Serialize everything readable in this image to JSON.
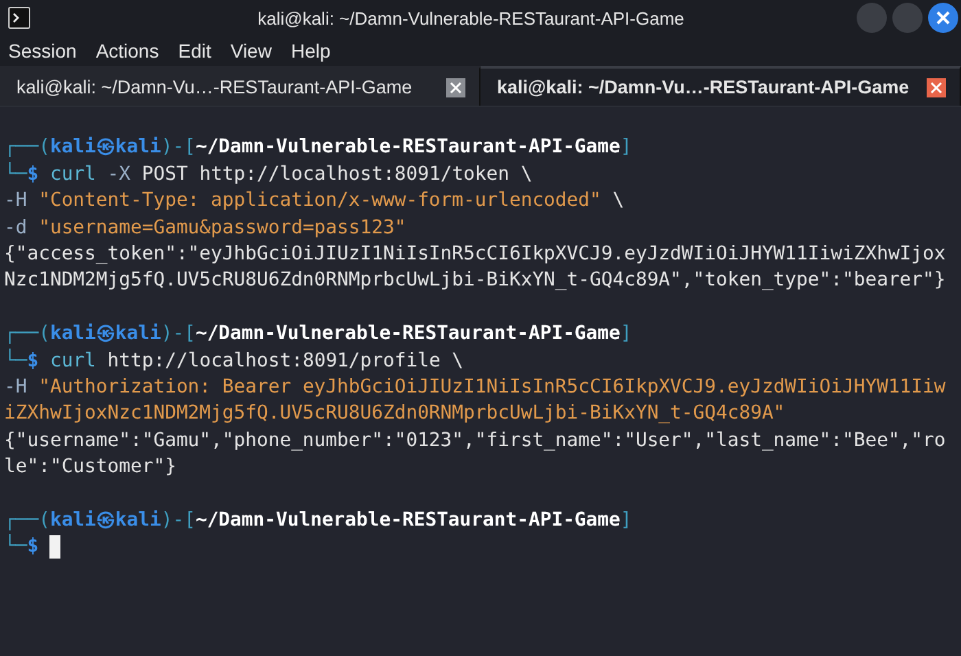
{
  "window": {
    "title": "kali@kali: ~/Damn-Vulnerable-RESTaurant-API-Game"
  },
  "menu": [
    "Session",
    "Actions",
    "Edit",
    "View",
    "Help"
  ],
  "tabs": [
    {
      "label": "kali@kali: ~/Damn-Vu…-RESTaurant-API-Game",
      "selected": false
    },
    {
      "label": "kali@kali: ~/Damn-Vu…-RESTaurant-API-Game",
      "selected": true
    }
  ],
  "terminal": {
    "lines": [
      {
        "kind": "blank"
      },
      {
        "kind": "prompt",
        "segments": [
          {
            "kind": "frame",
            "text": "┌──("
          },
          {
            "kind": "user",
            "text": "kali㉿kali"
          },
          {
            "kind": "frame",
            "text": ")-["
          },
          {
            "kind": "path",
            "text": "~/Damn-Vulnerable-RESTaurant-API-Game"
          },
          {
            "kind": "frame",
            "text": "]"
          }
        ]
      },
      {
        "kind": "command",
        "segments": [
          {
            "kind": "frame",
            "text": "└─"
          },
          {
            "kind": "dollar",
            "text": "$ "
          },
          {
            "kind": "cmd",
            "text": "curl "
          },
          {
            "kind": "option",
            "text": "-X "
          },
          {
            "kind": "plain",
            "text": "POST http://localhost:8091/token \\"
          }
        ]
      },
      {
        "kind": "command",
        "segments": [
          {
            "kind": "option",
            "text": "-H "
          },
          {
            "kind": "string",
            "text": "\"Content-Type: application/x-www-form-urlencoded\""
          },
          {
            "kind": "plain",
            "text": " \\"
          }
        ]
      },
      {
        "kind": "command",
        "segments": [
          {
            "kind": "option",
            "text": "-d "
          },
          {
            "kind": "string",
            "text": "\"username=Gamu&password=pass123\""
          }
        ]
      },
      {
        "kind": "output",
        "segments": [
          {
            "kind": "plain",
            "text": "{\"access_token\":\"eyJhbGciOiJIUzI1NiIsInR5cCI6IkpXVCJ9.eyJzdWIiOiJHYW11IiwiZXhwIjox"
          }
        ]
      },
      {
        "kind": "output",
        "segments": [
          {
            "kind": "plain",
            "text": "Nzc1NDM2Mjg5fQ.UV5cRU8U6Zdn0RNMprbcUwLjbi-BiKxYN_t-GQ4c89A\",\"token_type\":\"bearer\"}"
          }
        ]
      },
      {
        "kind": "blank"
      },
      {
        "kind": "prompt",
        "segments": [
          {
            "kind": "frame",
            "text": "┌──("
          },
          {
            "kind": "user",
            "text": "kali㉿kali"
          },
          {
            "kind": "frame",
            "text": ")-["
          },
          {
            "kind": "path",
            "text": "~/Damn-Vulnerable-RESTaurant-API-Game"
          },
          {
            "kind": "frame",
            "text": "]"
          }
        ]
      },
      {
        "kind": "command",
        "segments": [
          {
            "kind": "frame",
            "text": "└─"
          },
          {
            "kind": "dollar",
            "text": "$ "
          },
          {
            "kind": "cmd",
            "text": "curl "
          },
          {
            "kind": "plain",
            "text": "http://localhost:8091/profile \\"
          }
        ]
      },
      {
        "kind": "command",
        "segments": [
          {
            "kind": "option",
            "text": "-H "
          },
          {
            "kind": "string",
            "text": "\"Authorization: Bearer eyJhbGciOiJIUzI1NiIsInR5cCI6IkpXVCJ9.eyJzdWIiOiJHYW11Iiw"
          }
        ]
      },
      {
        "kind": "command",
        "segments": [
          {
            "kind": "string",
            "text": "iZXhwIjoxNzc1NDM2Mjg5fQ.UV5cRU8U6Zdn0RNMprbcUwLjbi-BiKxYN_t-GQ4c89A\""
          }
        ]
      },
      {
        "kind": "output",
        "segments": [
          {
            "kind": "plain",
            "text": "{\"username\":\"Gamu\",\"phone_number\":\"0123\",\"first_name\":\"User\",\"last_name\":\"Bee\",\"ro"
          }
        ]
      },
      {
        "kind": "output",
        "segments": [
          {
            "kind": "plain",
            "text": "le\":\"Customer\"}"
          }
        ]
      },
      {
        "kind": "blank"
      },
      {
        "kind": "prompt",
        "segments": [
          {
            "kind": "frame",
            "text": "┌──("
          },
          {
            "kind": "user",
            "text": "kali㉿kali"
          },
          {
            "kind": "frame",
            "text": ")-["
          },
          {
            "kind": "path",
            "text": "~/Damn-Vulnerable-RESTaurant-API-Game"
          },
          {
            "kind": "frame",
            "text": "]"
          }
        ]
      },
      {
        "kind": "command",
        "cursor": true,
        "segments": [
          {
            "kind": "frame",
            "text": "└─"
          },
          {
            "kind": "dollar",
            "text": "$"
          }
        ]
      }
    ]
  }
}
